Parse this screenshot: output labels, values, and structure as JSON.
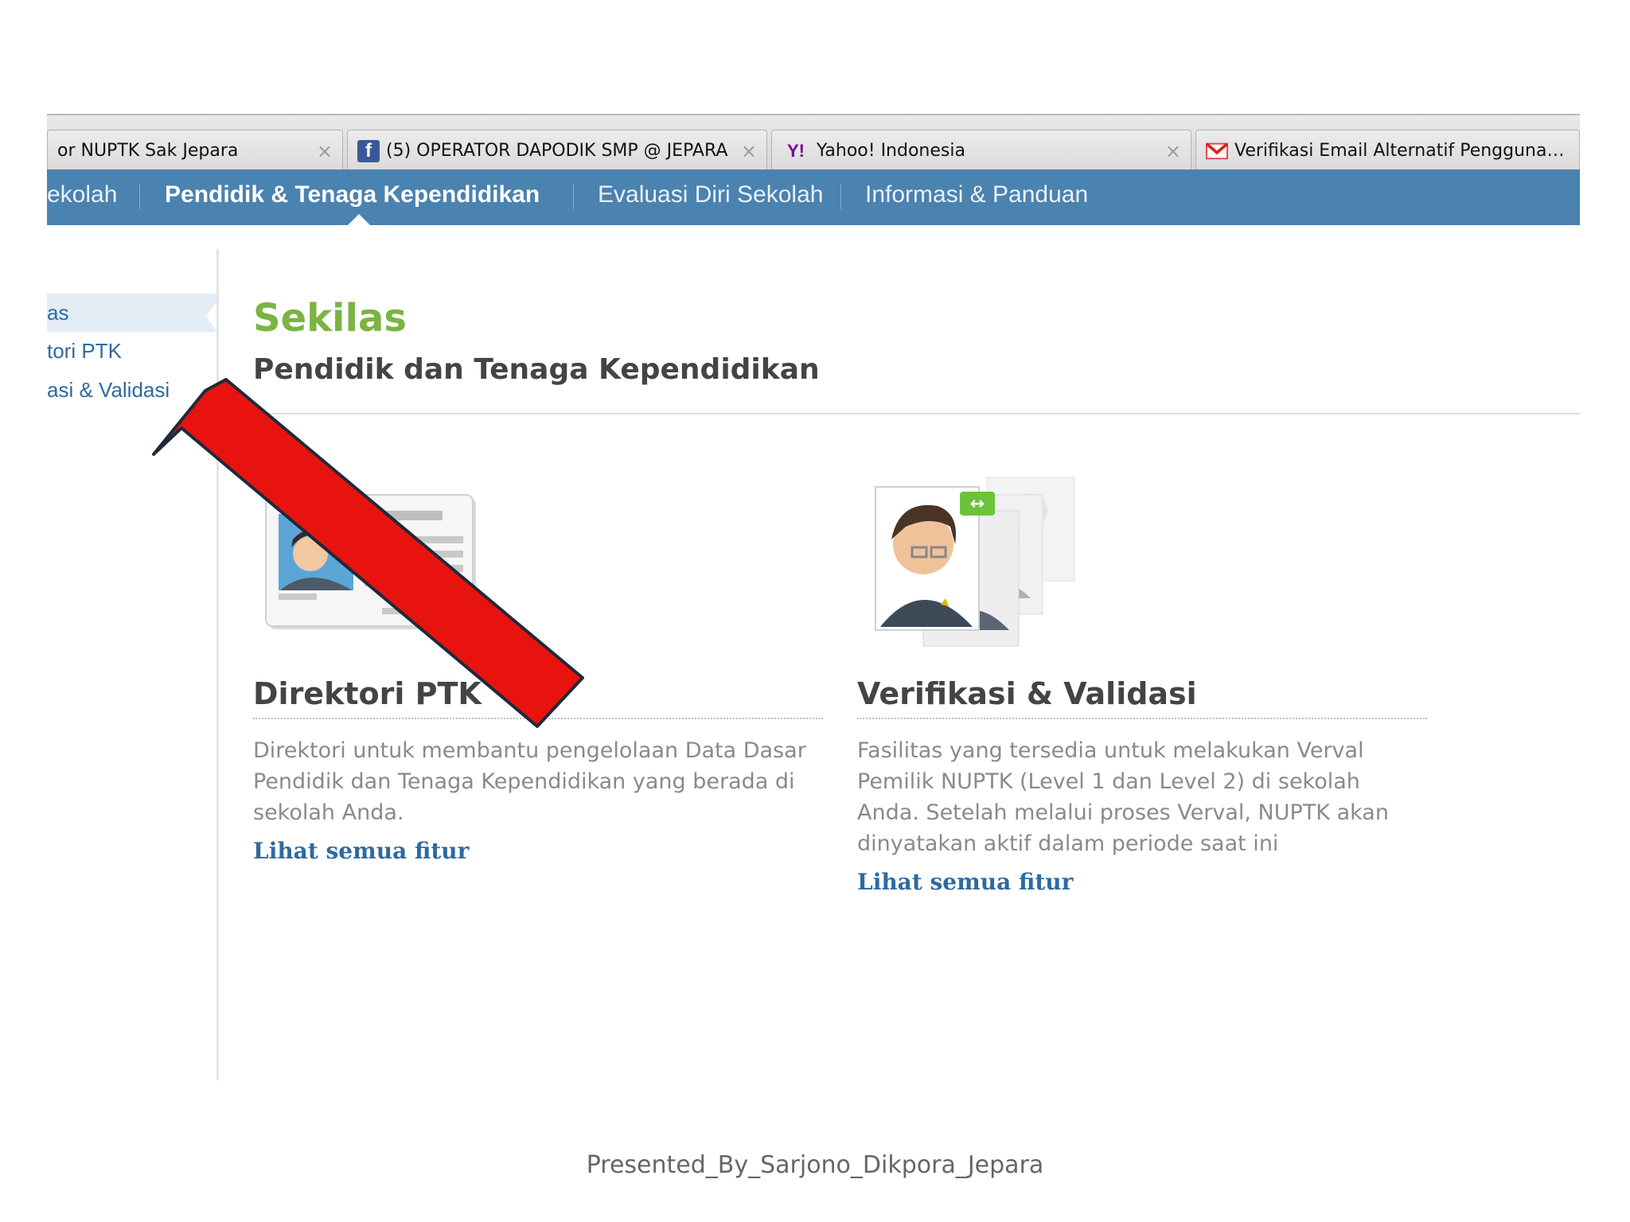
{
  "browser": {
    "tabs": [
      {
        "title": "or NUPTK Sak Jepara",
        "favicon": "none"
      },
      {
        "title": "(5) OPERATOR DAPODIK SMP @ JEPARA",
        "favicon": "facebook-icon"
      },
      {
        "title": "Yahoo! Indonesia",
        "favicon": "yahoo-icon"
      },
      {
        "title": "Verifikasi Email Alternatif Pengguna Laya...",
        "favicon": "gmail-icon"
      }
    ],
    "close_glyph": "×",
    "fb_glyph": "f",
    "yahoo_glyph": "Y!"
  },
  "nav": {
    "items": [
      {
        "label": "ekolah"
      },
      {
        "label": "Pendidik & Tenaga Kependidikan"
      },
      {
        "label": "Evaluasi Diri Sekolah"
      },
      {
        "label": "Informasi & Panduan"
      }
    ]
  },
  "sidebar": {
    "items": [
      {
        "label": "as"
      },
      {
        "label": "tori PTK"
      },
      {
        "label": "asi & Validasi"
      }
    ]
  },
  "main": {
    "title": "Sekilas",
    "subtitle": "Pendidik dan Tenaga Kependidikan",
    "features": [
      {
        "title": "Direktori PTK",
        "description": "Direktori untuk membantu pengelolaan Data Dasar Pendidik dan Tenaga Kependidikan yang berada di sekolah Anda.",
        "link": "Lihat semua fitur",
        "icon": "id-card-icon"
      },
      {
        "title": "Verifikasi & Validasi",
        "description": "Fasilitas yang tersedia untuk melakukan Verval Pemilik NUPTK (Level 1 dan Level 2) di sekolah Anda. Setelah melalui proses Verval, NUPTK akan dinyatakan aktif dalam periode saat ini",
        "link": "Lihat semua fitur",
        "icon": "verification-people-icon"
      }
    ]
  },
  "annotation": {
    "type": "red-arrow",
    "color": "#e8130f"
  },
  "footer": {
    "text": "Presented_By_Sarjono_Dikpora_Jepara"
  },
  "colors": {
    "nav_bg": "#4a82b0",
    "title_green": "#7bb441",
    "link_blue": "#2e6aa0"
  }
}
